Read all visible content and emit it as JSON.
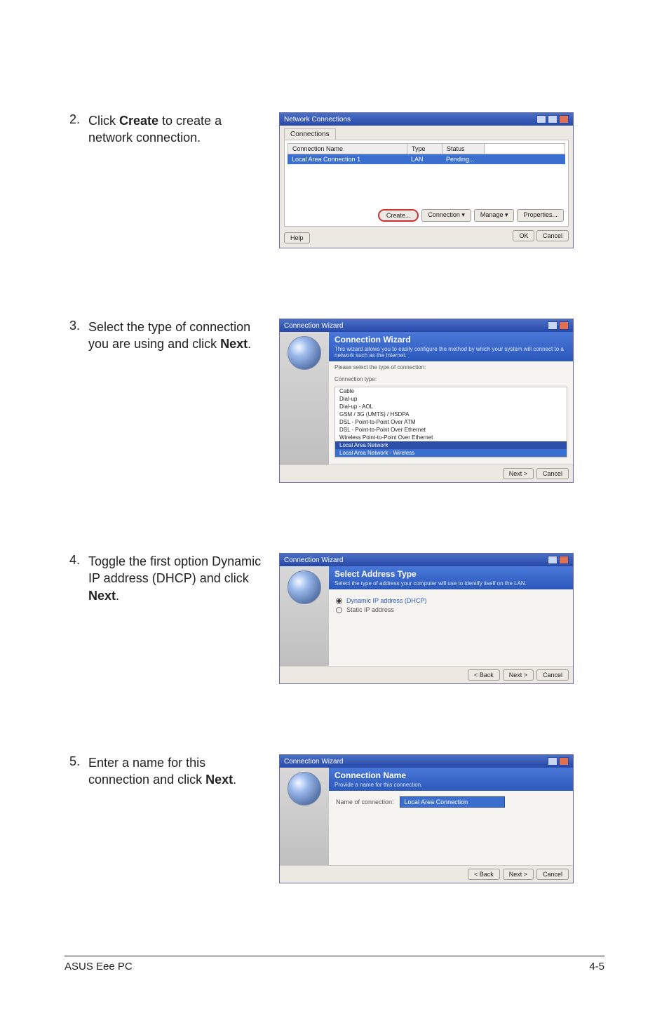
{
  "step2": {
    "number": "2.",
    "text_before": "Click ",
    "bold": "Create",
    "text_after": " to create a network connection."
  },
  "step3": {
    "number": "3.",
    "text_before": "Select the type of connection you are using and click ",
    "bold": "Next",
    "text_after": "."
  },
  "step4": {
    "number": "4.",
    "text_before": "Toggle the first option Dynamic IP address (DHCP) and click ",
    "bold": "Next",
    "text_after": "."
  },
  "step5": {
    "number": "5.",
    "text_before": "Enter a name for this connection and click ",
    "bold": "Next",
    "text_after": "."
  },
  "s1": {
    "title": "Network Connections",
    "tab": "Connections",
    "col_name": "Connection Name",
    "col_type": "Type",
    "col_status": "Status",
    "row_name": "Local Area Connection 1",
    "row_type": "LAN",
    "row_status": "Pending...",
    "btn_create": "Create...",
    "btn_connection": "Connection ▾",
    "btn_manage": "Manage ▾",
    "btn_properties": "Properties...",
    "btn_help": "Help",
    "btn_ok": "OK",
    "btn_cancel": "Cancel"
  },
  "s2": {
    "title": "Connection Wizard",
    "header": "Connection Wizard",
    "sub": "This wizard allows you to easily configure the method by which your system will connect to a network such as the Internet.",
    "desc": "Please select the type of connection:",
    "label": "Connection type:",
    "items": [
      "Cable",
      "Dial-up",
      "Dial-up - AOL",
      "GSM / 3G (UMTS) / HSDPA",
      "DSL - Point-to-Point Over ATM",
      "DSL - Point-to-Point Over Ethernet",
      "Wireless Point-to-Point Over Ethernet"
    ],
    "items_sel": [
      "Local Area Network",
      "Local Area Network - Wireless"
    ],
    "btn_next": "Next >",
    "btn_cancel": "Cancel"
  },
  "s3": {
    "title": "Connection Wizard",
    "header": "Select Address Type",
    "sub": "Select the type of address your computer will use to identify itself on the LAN.",
    "opt1": "Dynamic IP address (DHCP)",
    "opt2": "Static IP address",
    "btn_back": "< Back",
    "btn_next": "Next >",
    "btn_cancel": "Cancel"
  },
  "s4": {
    "title": "Connection Wizard",
    "header": "Connection Name",
    "sub": "Provide a name for this connection.",
    "label": "Name of connection:",
    "value": "Local Area Connection",
    "btn_back": "< Back",
    "btn_next": "Next >",
    "btn_cancel": "Cancel"
  },
  "footer": {
    "left": "ASUS Eee PC",
    "right": "4-5"
  }
}
